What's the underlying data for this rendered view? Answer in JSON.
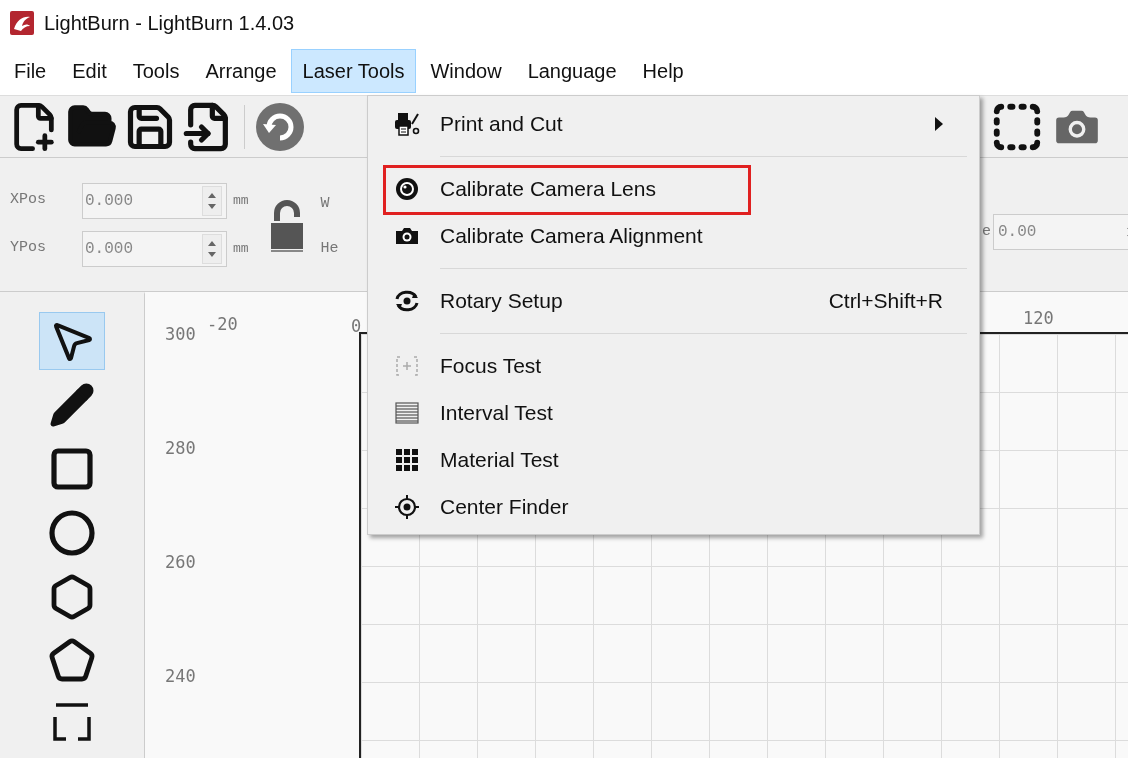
{
  "window": {
    "title": "LightBurn - LightBurn 1.4.03"
  },
  "menu_bar": [
    {
      "label": "File",
      "selected": false
    },
    {
      "label": "Edit",
      "selected": false
    },
    {
      "label": "Tools",
      "selected": false
    },
    {
      "label": "Arrange",
      "selected": false
    },
    {
      "label": "Laser Tools",
      "selected": true
    },
    {
      "label": "Window",
      "selected": false
    },
    {
      "label": "Language",
      "selected": false
    },
    {
      "label": "Help",
      "selected": false
    }
  ],
  "position_fields": [
    {
      "label": "XPos",
      "value": "0.000",
      "unit": "mm"
    },
    {
      "label": "YPos",
      "value": "0.000",
      "unit": "mm"
    }
  ],
  "size_labels": [
    "W",
    "He"
  ],
  "right_field": {
    "label_fragment": "e",
    "value": "0.00"
  },
  "tools": [
    {
      "selected": true
    },
    {
      "selected": false
    },
    {
      "selected": false
    },
    {
      "selected": false
    },
    {
      "selected": false
    },
    {
      "selected": false
    },
    {
      "selected": false
    }
  ],
  "ruler": {
    "x_labels": [
      "-20",
      "0",
      "120"
    ],
    "y_labels": [
      "300",
      "280",
      "260",
      "240"
    ]
  },
  "dropdown": {
    "items": [
      {
        "kind": "item",
        "label": "Print and Cut",
        "submenu": true,
        "highlighted": false
      },
      {
        "kind": "separator"
      },
      {
        "kind": "item",
        "label": "Calibrate Camera Lens",
        "submenu": false,
        "highlighted": true
      },
      {
        "kind": "item",
        "label": "Calibrate Camera Alignment",
        "submenu": false,
        "highlighted": false
      },
      {
        "kind": "separator"
      },
      {
        "kind": "item",
        "label": "Rotary Setup",
        "shortcut": "Ctrl+Shift+R",
        "submenu": false,
        "highlighted": false
      },
      {
        "kind": "separator"
      },
      {
        "kind": "item",
        "label": "Focus Test",
        "submenu": false,
        "highlighted": false
      },
      {
        "kind": "item",
        "label": "Interval Test",
        "submenu": false,
        "highlighted": false
      },
      {
        "kind": "item",
        "label": "Material Test",
        "submenu": false,
        "highlighted": false
      },
      {
        "kind": "item",
        "label": "Center Finder",
        "submenu": false,
        "highlighted": false
      }
    ]
  }
}
